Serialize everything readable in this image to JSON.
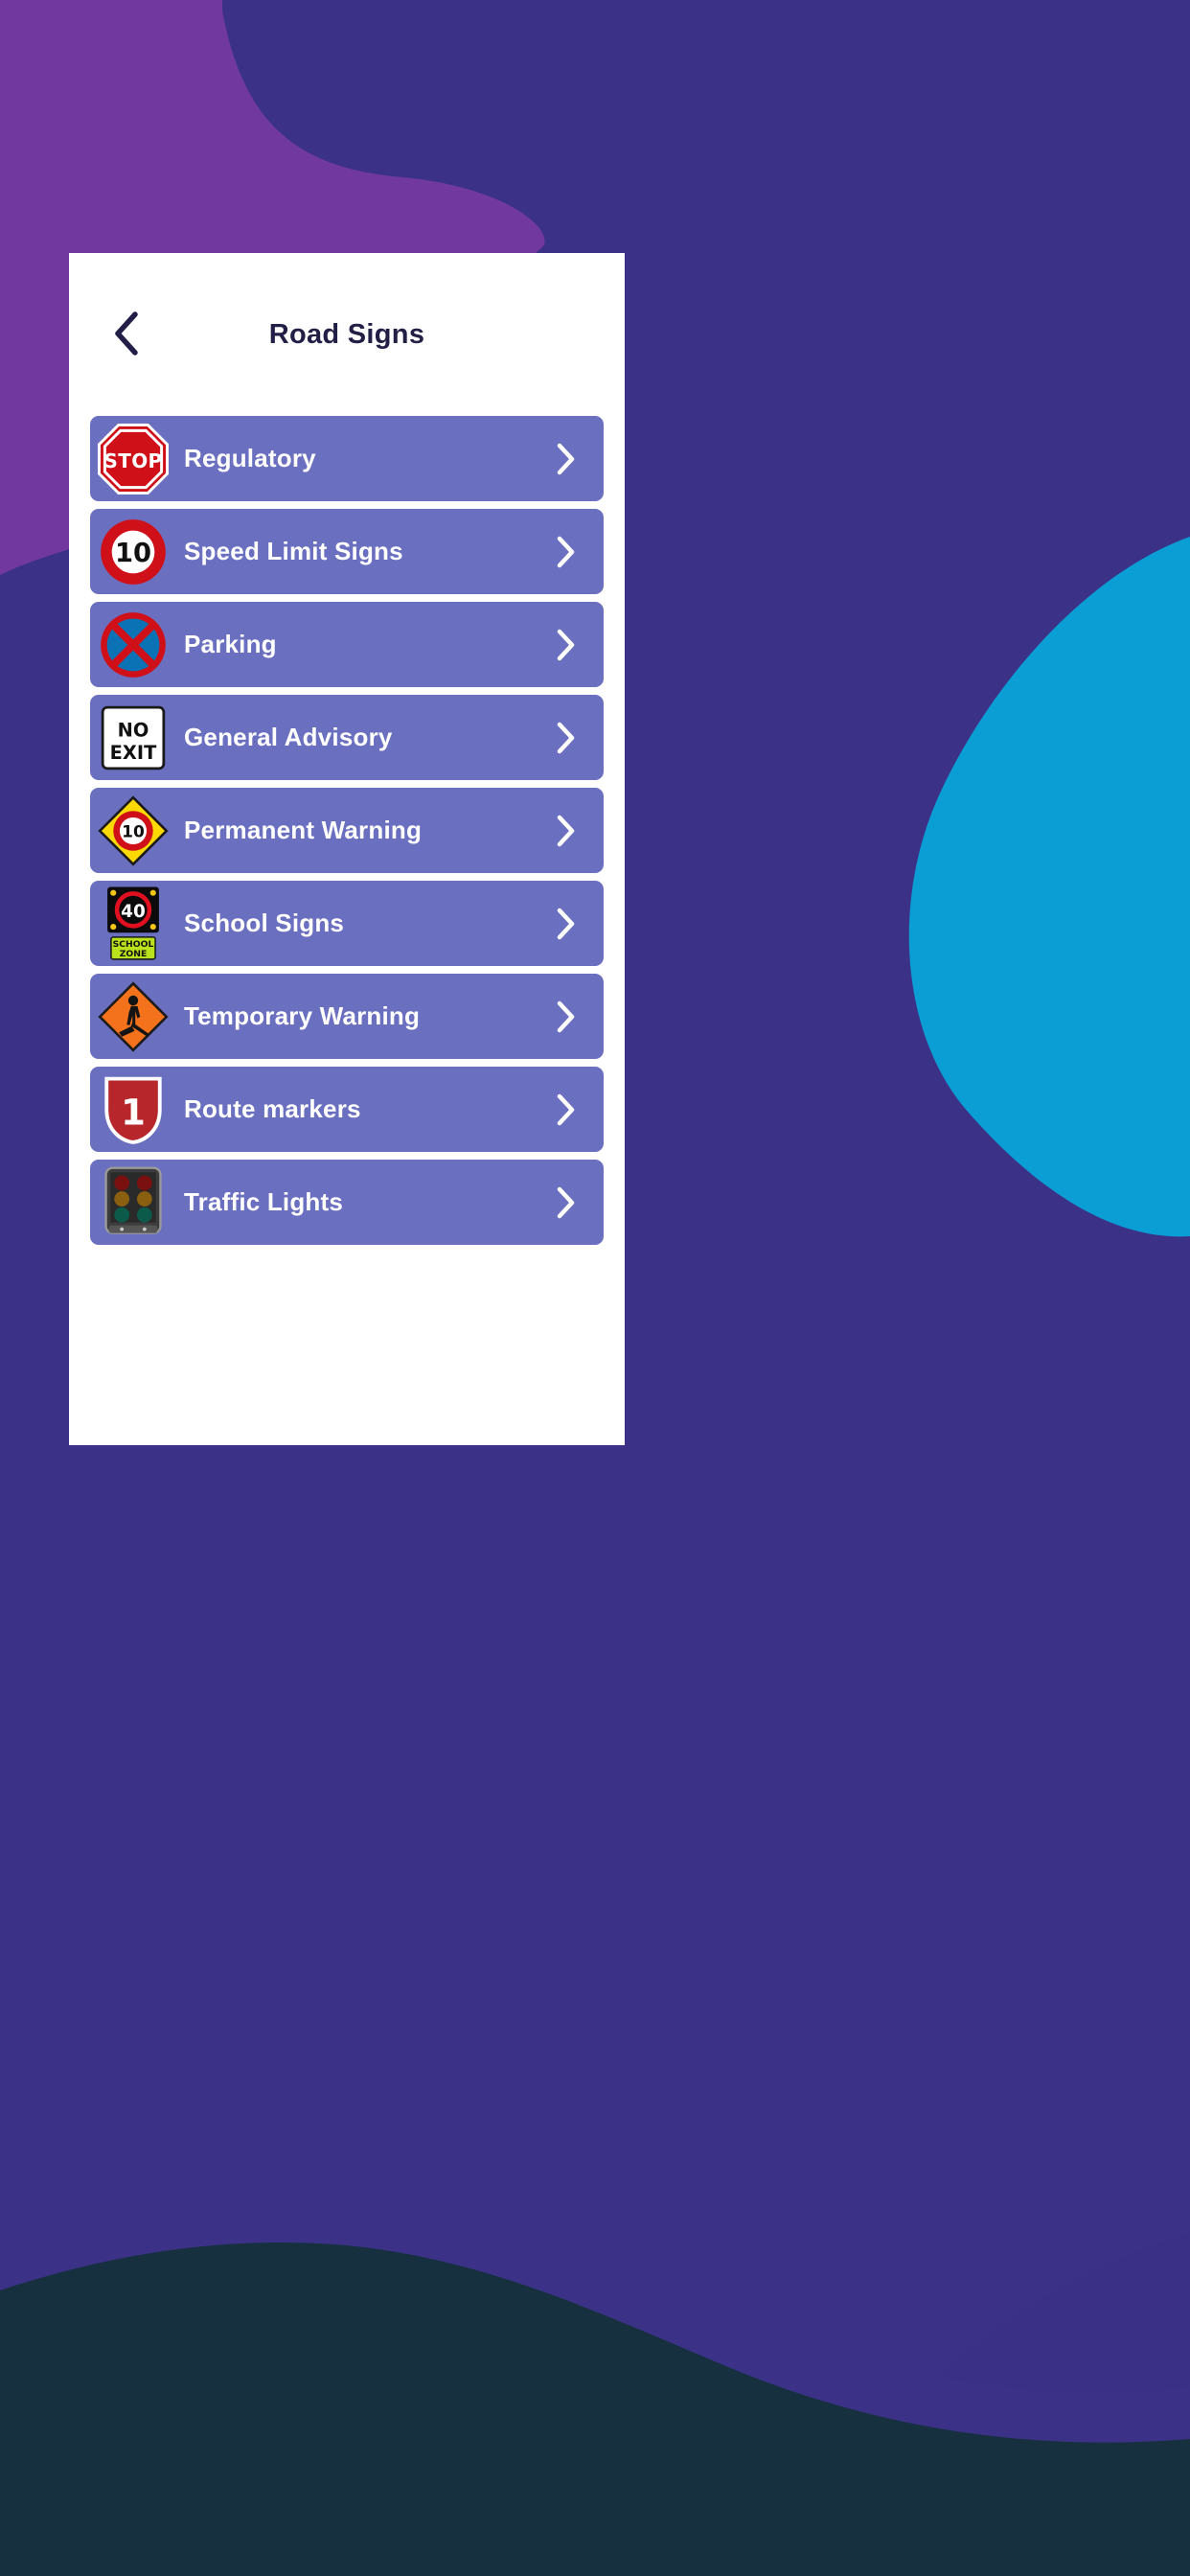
{
  "app": {
    "background_colors": {
      "deep_navy": "#3b3287",
      "purple": "#71399f",
      "indigo": "#3d3587",
      "cyan": "#0a9ed4",
      "dark_teal": "#17303f"
    },
    "card_background": "#ffffff",
    "row_color": "#6a6fc0",
    "title_color": "#221f47",
    "label_color": "#ffffff"
  },
  "header": {
    "title": "Road Signs",
    "back_icon": "chevron-left-icon"
  },
  "list": {
    "chevron_icon": "chevron-right-icon",
    "items": [
      {
        "label": "Regulatory",
        "icon": "stop-sign-icon",
        "sign_text": "STOP"
      },
      {
        "label": "Speed Limit Signs",
        "icon": "speed-limit-sign-icon",
        "sign_text": "10"
      },
      {
        "label": "Parking",
        "icon": "no-stopping-sign-icon",
        "sign_text": ""
      },
      {
        "label": "General Advisory",
        "icon": "no-exit-sign-icon",
        "sign_text": "NO EXIT"
      },
      {
        "label": "Permanent Warning",
        "icon": "warning-diamond-speed-icon",
        "sign_text": "10"
      },
      {
        "label": "School Signs",
        "icon": "school-zone-sign-icon",
        "sign_text": "40 SCHOOL ZONE"
      },
      {
        "label": "Temporary Warning",
        "icon": "roadworks-sign-icon",
        "sign_text": ""
      },
      {
        "label": "Route markers",
        "icon": "route-shield-icon",
        "sign_text": "1"
      },
      {
        "label": "Traffic Lights",
        "icon": "traffic-lights-icon",
        "sign_text": ""
      }
    ]
  }
}
